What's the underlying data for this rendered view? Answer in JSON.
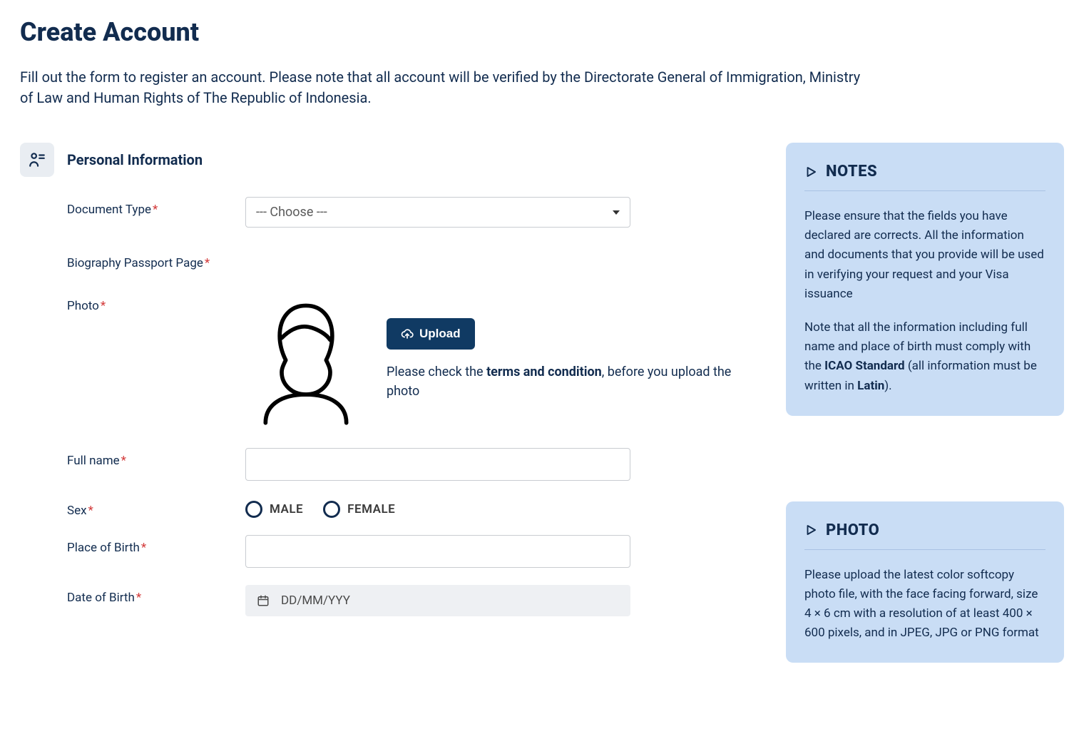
{
  "page": {
    "title": "Create Account",
    "description": "Fill out the form to register an account. Please note that all account will be verified by the Directorate General of Immigration, Ministry of Law and Human Rights of The Republic of Indonesia."
  },
  "section": {
    "title": "Personal Information"
  },
  "form": {
    "document_type": {
      "label": "Document Type",
      "required": true,
      "selected": "--- Choose ---"
    },
    "passport_page": {
      "label": "Biography Passport Page",
      "required": true
    },
    "photo": {
      "label": "Photo",
      "required": true,
      "upload_label": "Upload",
      "hint_pre": "Please check the ",
      "hint_bold": "terms and condition",
      "hint_post": ", before you upload the photo"
    },
    "full_name": {
      "label": "Full name",
      "required": true,
      "value": ""
    },
    "sex": {
      "label": "Sex",
      "required": true,
      "options": {
        "male": "MALE",
        "female": "FEMALE"
      }
    },
    "place_of_birth": {
      "label": "Place of Birth",
      "required": true,
      "value": ""
    },
    "date_of_birth": {
      "label": "Date of Birth",
      "required": true,
      "placeholder": "DD/MM/YYY"
    }
  },
  "notes_panel": {
    "title": "NOTES",
    "para1": "Please ensure that the fields you have declared are corrects. All the information and documents that you provide will be used in verifying your request and your Visa issuance",
    "para2_pre": "Note that all the information including full name and place of birth must comply with the ",
    "para2_bold1": "ICAO Standard",
    "para2_mid": " (all information must be written in ",
    "para2_bold2": "Latin",
    "para2_post": ")."
  },
  "photo_panel": {
    "title": "PHOTO",
    "para1": "Please upload the latest color softcopy photo file, with the face facing forward, size 4 × 6 cm with a resolution of at least 400 × 600 pixels, and in JPEG, JPG or PNG format"
  },
  "asterisk": "*"
}
